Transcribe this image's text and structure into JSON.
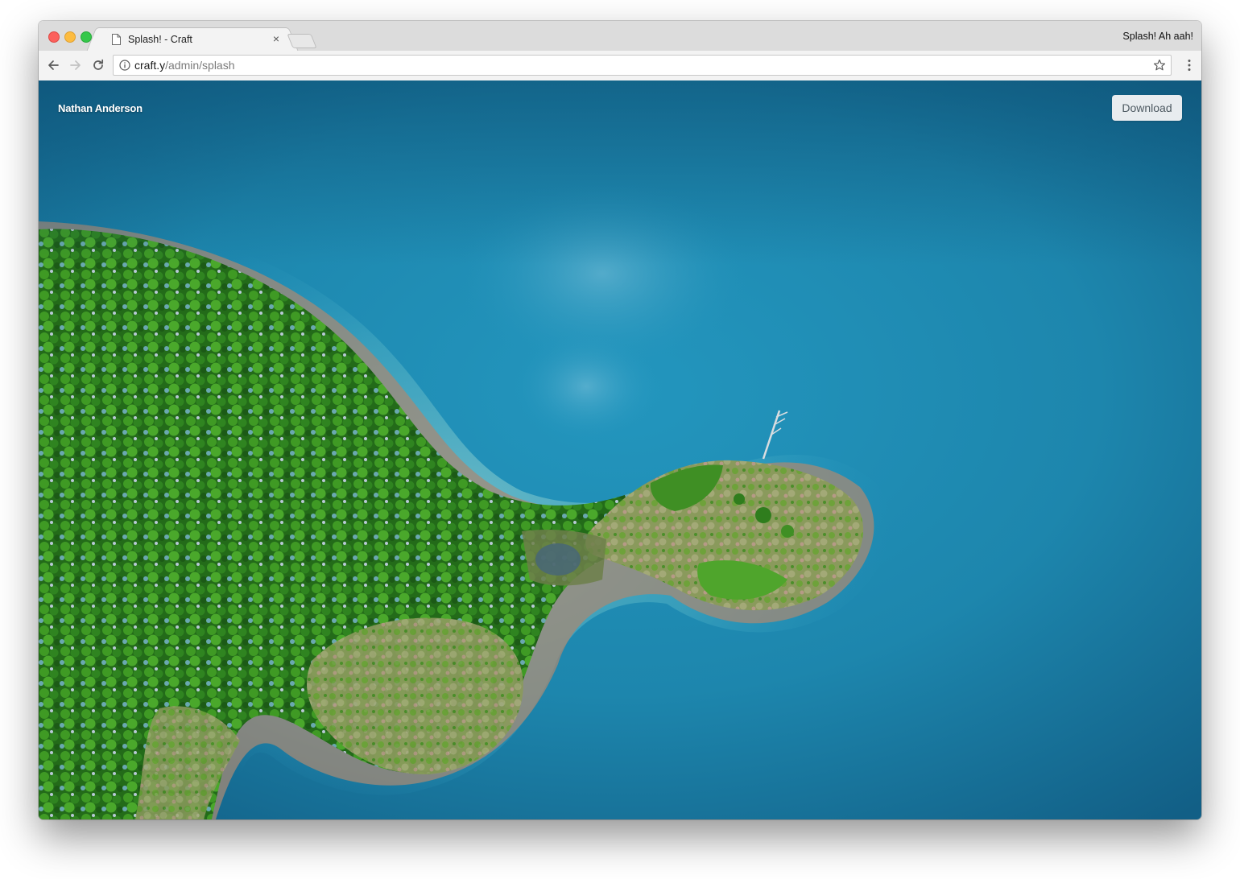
{
  "browser": {
    "tab": {
      "title": "Splash! - Craft",
      "close_glyph": "×",
      "icon": "document-icon"
    },
    "profile_name": "Splash! Ah aah!",
    "address_bar": {
      "host": "craft.y",
      "path": "/admin/splash",
      "icons": [
        "info-icon",
        "star-icon"
      ]
    },
    "nav_icons": [
      "back-arrow-icon",
      "forward-arrow-icon",
      "reload-icon",
      "kebab-menu-icon"
    ]
  },
  "splash": {
    "photographer": "Nathan Anderson",
    "download_label": "Download"
  },
  "colors": {
    "water": "#1f88ad",
    "forest": "#2e7d1e",
    "download_bg": "#e8ecef"
  }
}
